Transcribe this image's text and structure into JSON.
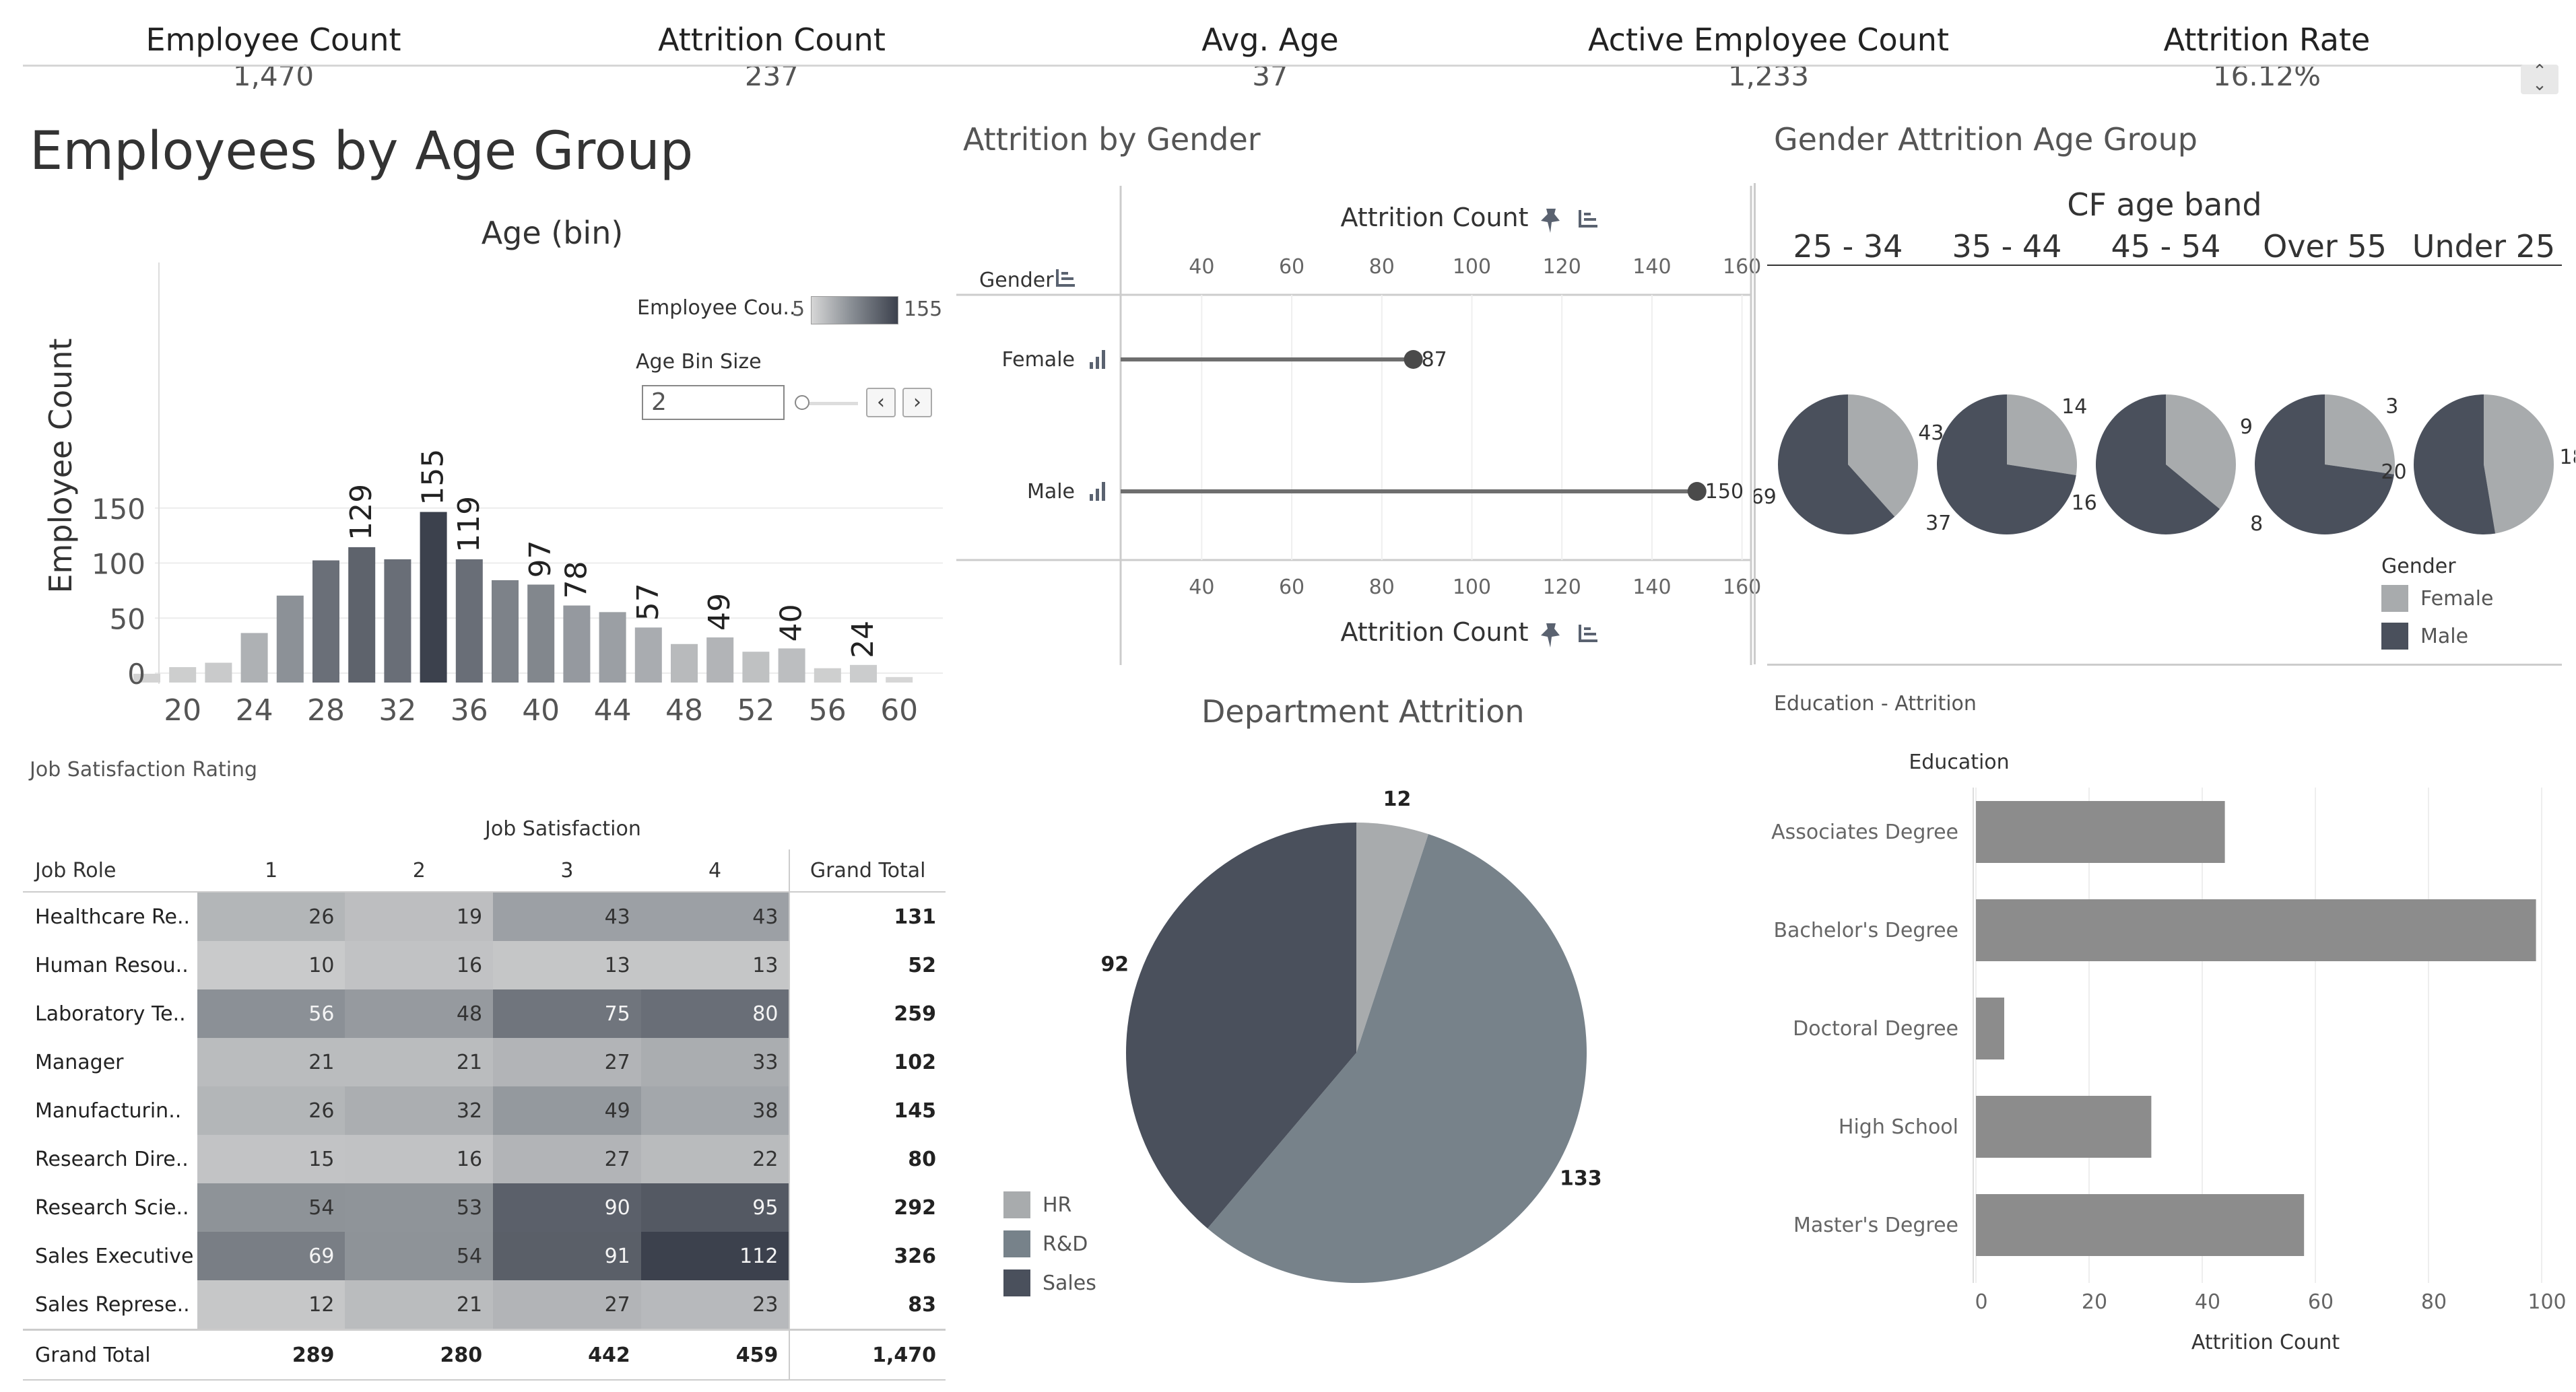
{
  "kpis": [
    {
      "label": "Employee Count",
      "value": "1,470"
    },
    {
      "label": "Attrition Count",
      "value": "237"
    },
    {
      "label": "Avg. Age",
      "value": "37"
    },
    {
      "label": "Active Employee Count",
      "value": "1,233"
    },
    {
      "label": "Attrition Rate",
      "value": "16.12%"
    }
  ],
  "age_panel": {
    "title": "Employees by Age Group",
    "chart_title": "Age (bin)",
    "ylabel": "Employee Count",
    "legend_label": "Employee Cou..",
    "legend_min": "5",
    "legend_max": "155",
    "bin_size_label": "Age Bin Size",
    "bin_size_value": "2"
  },
  "gender_panel": {
    "title": "Attrition by Gender",
    "axis_title": "Attrition Count",
    "row_header": "Gender"
  },
  "gender_age_panel": {
    "title": "Gender Attrition Age Group",
    "band_title": "CF age band",
    "legend_title": "Gender"
  },
  "dept_panel": {
    "title": "Department Attrition"
  },
  "job_panel": {
    "title": "Job Satisfaction Rating",
    "col_group": "Job Satisfaction",
    "row_header": "Job Role",
    "cols": [
      "1",
      "2",
      "3",
      "4"
    ],
    "total_label": "Grand Total"
  },
  "edu_panel": {
    "title": "Education - Attrition",
    "row_header": "Education",
    "xlabel": "Attrition Count"
  },
  "colors": {
    "dark": "#4a505c",
    "mid": "#77828a",
    "light": "#a8abad",
    "bar_grey": "#8c8c8c"
  },
  "chart_data": [
    {
      "type": "bar",
      "title": "Age (bin)",
      "ylabel": "Employee Count",
      "x": [
        18,
        20,
        22,
        24,
        26,
        28,
        30,
        32,
        34,
        36,
        38,
        40,
        42,
        44,
        46,
        48,
        50,
        52,
        54,
        56,
        58,
        60
      ],
      "values": [
        8,
        14,
        18,
        45,
        79,
        111,
        123,
        112,
        155,
        112,
        93,
        89,
        70,
        64,
        50,
        35,
        41,
        28,
        31,
        13,
        16,
        5
      ],
      "data_labels": [
        {
          "x": 30,
          "label": "129"
        },
        {
          "x": 34,
          "label": "155"
        },
        {
          "x": 36,
          "label": "119"
        },
        {
          "x": 40,
          "label": "97"
        },
        {
          "x": 42,
          "label": "78"
        },
        {
          "x": 46,
          "label": "57"
        },
        {
          "x": 50,
          "label": "49"
        },
        {
          "x": 54,
          "label": "40"
        },
        {
          "x": 58,
          "label": "24"
        }
      ],
      "x_ticks": [
        "20",
        "24",
        "28",
        "32",
        "36",
        "40",
        "44",
        "48",
        "52",
        "56",
        "60"
      ],
      "y_ticks": [
        "0",
        "50",
        "100",
        "150"
      ],
      "ylim": [
        0,
        200
      ],
      "grid": true
    },
    {
      "type": "scatter",
      "title": "Attrition Count",
      "categories": [
        "Female",
        "Male"
      ],
      "values": [
        87,
        150
      ],
      "data_labels": [
        "87",
        "150"
      ],
      "x_ticks": [
        "40",
        "60",
        "80",
        "100",
        "120",
        "140",
        "160"
      ],
      "xlim": [
        22,
        162
      ]
    },
    {
      "type": "pie",
      "title": "CF age band",
      "groups": [
        {
          "band": "25 - 34",
          "female": 43,
          "male": 69
        },
        {
          "band": "35 - 44",
          "female": 14,
          "male": 37
        },
        {
          "band": "45 - 54",
          "female": 9,
          "male": 16
        },
        {
          "band": "Over 55",
          "female": 3,
          "male": 8
        },
        {
          "band": "Under 25",
          "female": 18,
          "male": 20
        }
      ],
      "legend": [
        "Female",
        "Male"
      ]
    },
    {
      "type": "pie",
      "title": "Department Attrition",
      "labels": [
        "HR",
        "R&D",
        "Sales"
      ],
      "values": [
        12,
        133,
        92
      ]
    },
    {
      "type": "table",
      "title": "Job Satisfaction Rating",
      "columns": [
        "1",
        "2",
        "3",
        "4",
        "Grand Total"
      ],
      "rows": [
        {
          "role": "Healthcare Re..",
          "values": [
            26,
            19,
            43,
            43
          ],
          "total": "131"
        },
        {
          "role": "Human Resou..",
          "values": [
            10,
            16,
            13,
            13
          ],
          "total": "52"
        },
        {
          "role": "Laboratory Te..",
          "values": [
            56,
            48,
            75,
            80
          ],
          "total": "259"
        },
        {
          "role": "Manager",
          "values": [
            21,
            21,
            27,
            33
          ],
          "total": "102"
        },
        {
          "role": "Manufacturin..",
          "values": [
            26,
            32,
            49,
            38
          ],
          "total": "145"
        },
        {
          "role": "Research Dire..",
          "values": [
            15,
            16,
            27,
            22
          ],
          "total": "80"
        },
        {
          "role": "Research Scie..",
          "values": [
            54,
            53,
            90,
            95
          ],
          "total": "292"
        },
        {
          "role": "Sales Executive",
          "values": [
            69,
            54,
            91,
            112
          ],
          "total": "326"
        },
        {
          "role": "Sales Represe..",
          "values": [
            12,
            21,
            27,
            23
          ],
          "total": "83"
        }
      ],
      "grand_total": {
        "role": "Grand Total",
        "values": [
          "289",
          "280",
          "442",
          "459"
        ],
        "total": "1,470"
      }
    },
    {
      "type": "bar",
      "title": "Education - Attrition",
      "orientation": "horizontal",
      "categories": [
        "Associates Degree",
        "Bachelor's Degree",
        "Doctoral Degree",
        "High School",
        "Master's Degree"
      ],
      "values": [
        44,
        99,
        5,
        31,
        58
      ],
      "xlabel": "Attrition Count",
      "x_ticks": [
        "0",
        "20",
        "40",
        "60",
        "80",
        "100"
      ],
      "xlim": [
        0,
        100
      ],
      "grid": true
    }
  ]
}
